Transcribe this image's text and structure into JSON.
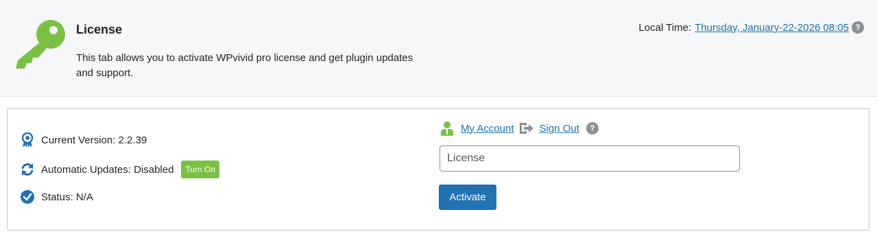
{
  "header": {
    "title": "License",
    "description": "This tab allows you to activate WPvivid pro license and get plugin updates and support.",
    "local_time_label": "Local Time:",
    "local_time_value": "Thursday, January-22-2026 08:05",
    "help_glyph": "?"
  },
  "status": {
    "version_text": "Current Version: 2.2.39",
    "updates_text": "Automatic Updates: Disabled",
    "turn_on_label": "Turn On",
    "status_text": "Status: N/A"
  },
  "account": {
    "my_account_label": "My Account",
    "sign_out_label": "Sign Out",
    "help_glyph": "?",
    "license_placeholder": "License",
    "activate_label": "Activate"
  },
  "colors": {
    "accent": "#2271b1",
    "key_green": "#7ac143",
    "help_gray": "#8c8f94",
    "header_bg": "#f6f7f9"
  },
  "icons": {
    "key": "key-icon",
    "version": "award-ribbon-icon",
    "updates": "refresh-icon",
    "status": "check-circle-icon",
    "account": "user-icon",
    "signout": "sign-out-icon",
    "help": "help-icon"
  }
}
